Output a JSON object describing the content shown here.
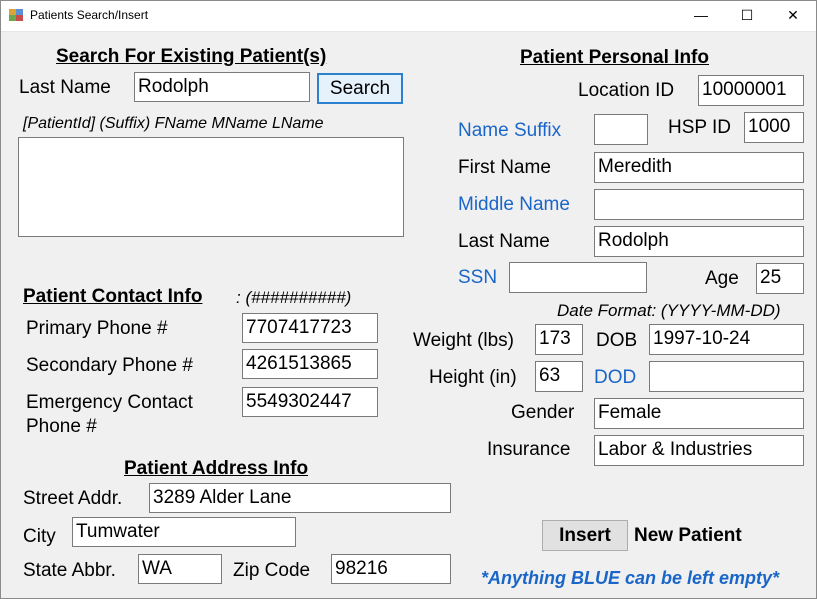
{
  "window": {
    "title": "Patients Search/Insert",
    "minimize_glyph": "—",
    "maximize_glyph": "☐",
    "close_glyph": "✕"
  },
  "search": {
    "heading": "Search For Existing Patient(s)",
    "last_name_label": "Last Name",
    "last_name_value": "Rodolph",
    "button_label": "Search",
    "results_format": "[PatientId] (Suffix) FName MName LName",
    "results": []
  },
  "contact": {
    "heading": "Patient Contact Info",
    "format_hint": ": (##########)",
    "primary_label": "Primary Phone #",
    "primary_value": "7707417723",
    "secondary_label": "Secondary Phone #",
    "secondary_value": "4261513865",
    "emergency_label_line1": "Emergency Contact",
    "emergency_label_line2": "Phone #",
    "emergency_value": "5549302447"
  },
  "address": {
    "heading": "Patient Address Info",
    "street_label": "Street Addr.",
    "street_value": "3289 Alder Lane",
    "city_label": "City",
    "city_value": "Tumwater",
    "state_label": "State Abbr.",
    "state_value": "WA",
    "zip_label": "Zip Code",
    "zip_value": "98216"
  },
  "personal": {
    "heading": "Patient Personal Info",
    "location_label": "Location ID",
    "location_value": "10000001",
    "suffix_label": "Name Suffix",
    "suffix_value": "",
    "hsp_label": "HSP ID",
    "hsp_value": "1000",
    "first_label": "First Name",
    "first_value": "Meredith",
    "middle_label": "Middle Name",
    "middle_value": "",
    "last_label": "Last Name",
    "last_value": "Rodolph",
    "ssn_label": "SSN",
    "ssn_value": "",
    "age_label": "Age",
    "age_value": "25",
    "date_format_hint": "Date Format: (YYYY-MM-DD)",
    "weight_label": "Weight (lbs)",
    "weight_value": "173",
    "dob_label": "DOB",
    "dob_value": "1997-10-24",
    "height_label": "Height (in)",
    "height_value": "63",
    "dod_label": "DOD",
    "dod_value": "",
    "gender_label": "Gender",
    "gender_value": "Female",
    "insurance_label": "Insurance",
    "insurance_value": "Labor & Industries"
  },
  "insert": {
    "button_label": "Insert",
    "suffix_text": "New Patient",
    "note": "*Anything BLUE can be left empty*"
  },
  "colors": {
    "optional_label": "#1a66c8",
    "background": "#f0f0f0",
    "search_button_border": "#2d7fd0"
  }
}
